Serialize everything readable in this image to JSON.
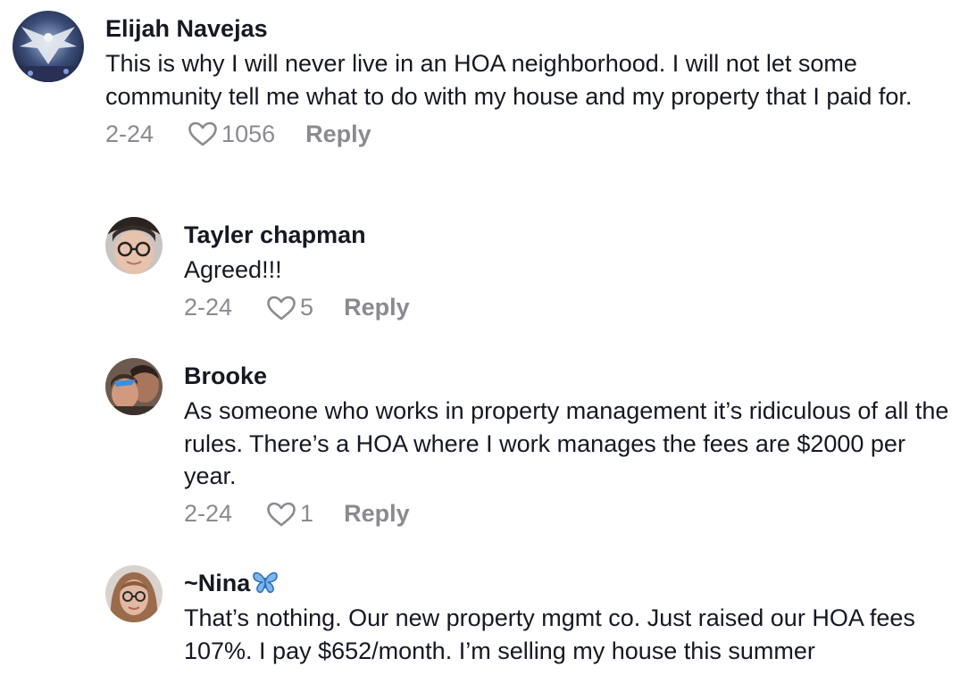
{
  "comments": [
    {
      "username": "Elijah Navejas",
      "text": "This is why I will never live in an HOA neighborhood. I will not let some community tell me what to do with my house and my property that I paid for.",
      "date": "2-24",
      "likes": "1056",
      "reply_label": "Reply"
    },
    {
      "username": "Tayler chapman",
      "text": "Agreed!!!",
      "date": "2-24",
      "likes": "5",
      "reply_label": "Reply"
    },
    {
      "username": "Brooke",
      "text": "As someone who works in property management it’s ridiculous of all the rules. There’s a HOA where I work manages the fees are $2000 per year.",
      "date": "2-24",
      "likes": "1",
      "reply_label": "Reply"
    },
    {
      "username": "~Nina",
      "username_emoji": "butterfly-icon",
      "text": "That’s nothing. Our new property mgmt co. Just raised our HOA fees 107%. I pay $652/month. I’m selling my house this summer"
    }
  ],
  "colors": {
    "text": "#161823",
    "meta": "#8a8b91",
    "butterfly": "#4a90d9"
  }
}
